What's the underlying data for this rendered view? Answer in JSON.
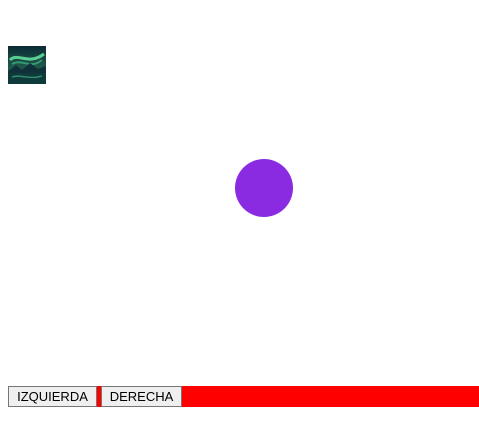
{
  "image": {
    "alt": "aurora-landscape-thumbnail"
  },
  "ball": {
    "color": "#8a2be2"
  },
  "controls": {
    "bar_color": "#ff0000",
    "left_label": "IZQUIERDA",
    "right_label": "DERECHA"
  }
}
